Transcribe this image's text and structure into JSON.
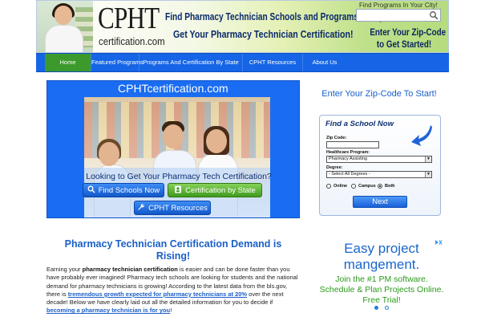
{
  "header": {
    "logo_main": "CPHT",
    "logo_sub": "certification.com",
    "tagline_1": "Find Pharmacy Technician Schools and Programs Today!",
    "tagline_2": "Get Your Pharmacy Technician Certification!",
    "search_label": "Find Programs In Your City!",
    "zip_cta_1": "Enter Your Zip-Code",
    "zip_cta_2": "to Get Started!"
  },
  "nav": {
    "items": [
      {
        "label": "Home",
        "active": true
      },
      {
        "label": "Featured Programs",
        "active": false
      },
      {
        "label": "Programs And Certification By State",
        "active": false
      },
      {
        "label": "CPHT Resources",
        "active": false
      },
      {
        "label": "About Us",
        "active": false
      }
    ]
  },
  "banner": {
    "title": "CPHTcertification.com",
    "headline": "Looking to Get Your Pharmacy Tech Certification?",
    "buttons": {
      "schools": "Find Schools Now",
      "state": "Certification by State",
      "resources": "CPHT Resources"
    }
  },
  "article": {
    "title": "Pharmacy Technician Certification Demand is Rising!",
    "p1_a": "Earning your ",
    "p1_b": "pharmacy technician certification",
    "p1_c": " is easier and can be done faster than you have probably ever imagined! Pharmacy tech schools are looking for students and the national demand for pharmacy technicians is growing! According to the latest data from the bls.gov, there is ",
    "p1_d": "tremendous growth expected for pharmacy technicians at 20%",
    "p1_e": " over the next decade! Below we have clearly laid out all the detailed information for you to decide if ",
    "p1_f": "becoming a pharmacy technician is for you",
    "p1_g": "!"
  },
  "sidebar": {
    "heading": "Enter Your Zip-Code To Start!",
    "form": {
      "title": "Find a School Now",
      "zip_label": "Zip Code:",
      "zip_value": "",
      "program_label": "Healthcare Program:",
      "program_value": "Pharmacy Assisting",
      "degree_label": "Degree:",
      "degree_value": "- Select All Degrees -",
      "radio_online": "Online",
      "radio_campus": "Campus",
      "radio_both": "Both",
      "selected_radio": "Both",
      "next_label": "Next"
    }
  },
  "ad": {
    "title": "Easy project mangement.",
    "body": "Join the #1 PM software. Schedule & Plan Projects Online. Free Trial!",
    "close_icon": "ad-choices-icon"
  },
  "colors": {
    "nav_blue": "#1565e6",
    "nav_active_green": "#3c9a2c",
    "heading_blue": "#1a5fc8",
    "ad_green": "#2a9a1a"
  }
}
